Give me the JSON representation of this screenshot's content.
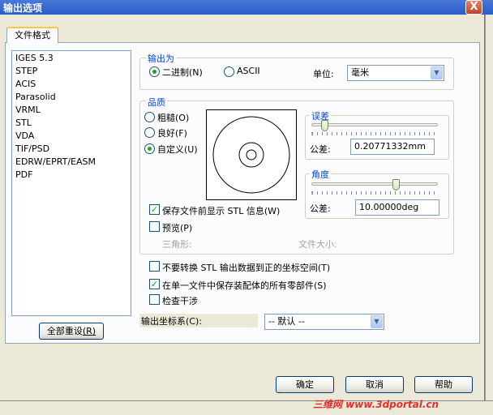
{
  "window": {
    "title": "输出选项",
    "close_glyph": "X"
  },
  "tab": {
    "label": "文件格式"
  },
  "formats": [
    "IGES 5.3",
    "STEP",
    "ACIS",
    "Parasolid",
    "VRML",
    "STL",
    "VDA",
    "TIF/PSD",
    "EDRW/EPRT/EASM",
    "PDF"
  ],
  "selected_format": "STL",
  "reset_all": {
    "label": "全部重设",
    "hotkey": "(R)"
  },
  "output_as": {
    "group_label": "输出为",
    "binary_label": "二进制",
    "binary_hotkey": "(N)",
    "ascii_label": "ASCII",
    "selected": "binary",
    "unit_label": "单位:",
    "unit_value": "毫米"
  },
  "quality": {
    "group_label": "品质",
    "coarse_label": "粗糙",
    "coarse_hotkey": "(O)",
    "fine_label": "良好",
    "fine_hotkey": "(F)",
    "custom_label": "自定义",
    "custom_hotkey": "(U)",
    "selected": "custom"
  },
  "deviation": {
    "group_label": "误差",
    "tolerance_label": "公差:",
    "value": "0.20771332mm",
    "slider_fraction": 0.08
  },
  "angle": {
    "group_label": "角度",
    "tolerance_label": "公差:",
    "value": "10.00000deg",
    "slider_fraction": 0.68
  },
  "show_info": {
    "label": "保存文件前显示 STL 信息",
    "hotkey": "(W)",
    "checked": true
  },
  "preview_check": {
    "label": "预览",
    "hotkey": "(P)",
    "checked": false
  },
  "triangles_label": "三角形:",
  "filesize_label": "文件大小:",
  "no_transform": {
    "label": "不要转换 STL 输出数据到正的坐标空间",
    "hotkey": "(T)",
    "checked": false
  },
  "single_file": {
    "label": "在单一文件中保存装配体的所有零部件",
    "hotkey": "(S)",
    "checked": true
  },
  "interference": {
    "label": "检查干涉",
    "checked": false
  },
  "coord_system": {
    "label": "输出坐标系",
    "hotkey": "(C)",
    "colon": ":",
    "value": "-- 默认 --"
  },
  "buttons": {
    "ok": "确定",
    "cancel": "取消",
    "help": "帮助"
  },
  "watermark": "三维网 www.3dportal.cn",
  "colors": {
    "titlebar": "#2a5cc8",
    "dialog_bg": "#ece9d8",
    "panel_bg": "#fcfcfe",
    "group_label": "#0046d5",
    "check_green": "#21a121"
  }
}
